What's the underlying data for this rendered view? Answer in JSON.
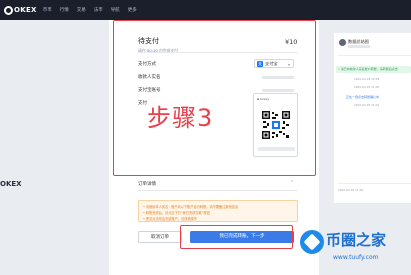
{
  "topbar": {
    "brand": "OKEX",
    "nav": [
      "币币",
      "行情",
      "交易",
      "法币",
      "导航",
      "更多"
    ]
  },
  "left_ad": {
    "text": "OKEX"
  },
  "payment": {
    "title": "待支付",
    "countdown_prefix": "请在",
    "countdown_time": "00:10",
    "countdown_suffix": "内完成支付",
    "amount": "¥10",
    "method_label": "支付方式",
    "method_value": "支付宝",
    "payee_name_label": "收款人实名",
    "account_label": "支付宝账号",
    "qr_label": "支付",
    "step_overlay": "步骤3"
  },
  "order_detail": {
    "label": "订单详情"
  },
  "warning": {
    "lines": [
      "• 请使用本人实名 · 账户向以下账户自行转账，请不要备注其他信息",
      "• 转账完成后，请点击下方“我已完成付款”按钮",
      "• 恶意点击将会冻结账户，请谨慎操作"
    ]
  },
  "buttons": {
    "cancel": "取消订单",
    "paid": "我已完成转账，下一步"
  },
  "chat": {
    "title": "数据总结图",
    "notice": "• 请已向收款人实名账户转账，请转账后点击",
    "timestamps": [
      "2020-03-25 10:59",
      "2020-03-25 11:00",
      "2020-03-25 11:01"
    ],
    "messages": [
      "正在一键点击转账确认中"
    ],
    "bottom_ts": [
      "2020-03-25 11:00"
    ]
  },
  "watermark": {
    "title": "币圈之家",
    "url": "www.tuufy.com"
  },
  "colors": {
    "accent_blue": "#3a7be8",
    "alert_red": "#e8404a",
    "warn_orange": "#e07f1d"
  }
}
